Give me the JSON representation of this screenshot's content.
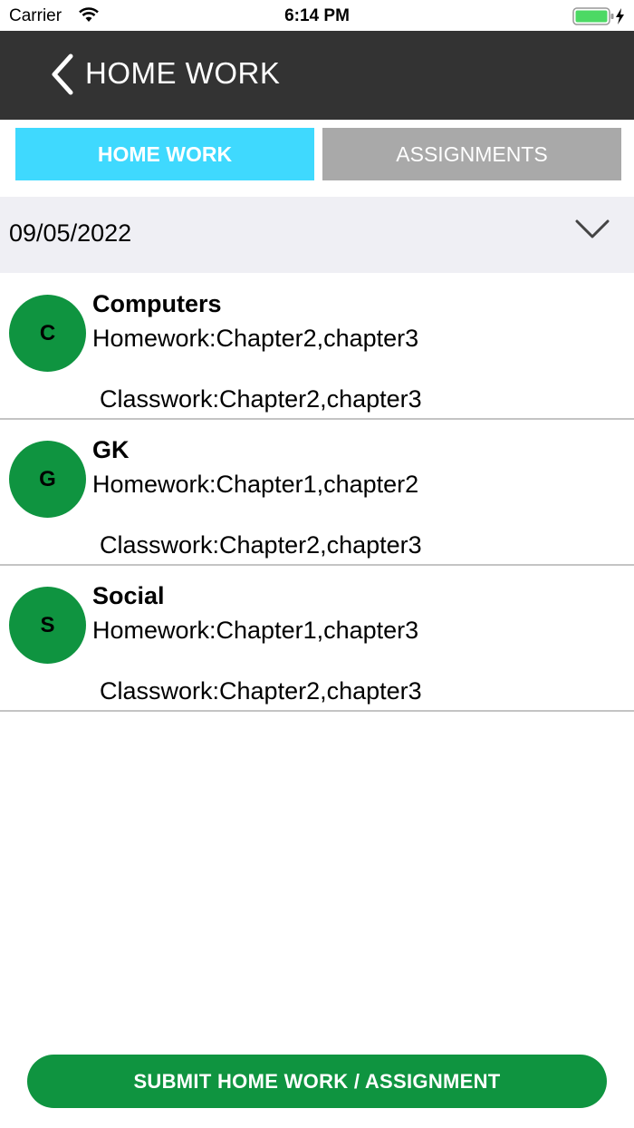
{
  "status_bar": {
    "carrier": "Carrier",
    "time": "6:14 PM"
  },
  "header": {
    "title": "HOME WORK"
  },
  "tabs": [
    {
      "label": "HOME WORK"
    },
    {
      "label": "ASSIGNMENTS"
    }
  ],
  "date_selector": {
    "value": "09/05/2022"
  },
  "items": [
    {
      "initial": "C",
      "subject": "Computers",
      "homework": "Homework:Chapter2,chapter3",
      "classwork": "Classwork:Chapter2,chapter3"
    },
    {
      "initial": "G",
      "subject": "GK",
      "homework": "Homework:Chapter1,chapter2",
      "classwork": "Classwork:Chapter2,chapter3"
    },
    {
      "initial": "S",
      "subject": "Social",
      "homework": "Homework:Chapter1,chapter3",
      "classwork": "Classwork:Chapter2,chapter3"
    }
  ],
  "submit_button": {
    "label": "SUBMIT HOME WORK / ASSIGNMENT"
  },
  "colors": {
    "accent_tab": "#3fd9fe",
    "green": "#0f9440",
    "navbar": "#333333"
  },
  "icons": [
    "wifi-icon",
    "battery-icon",
    "back-chevron-icon",
    "chevron-down-icon"
  ]
}
